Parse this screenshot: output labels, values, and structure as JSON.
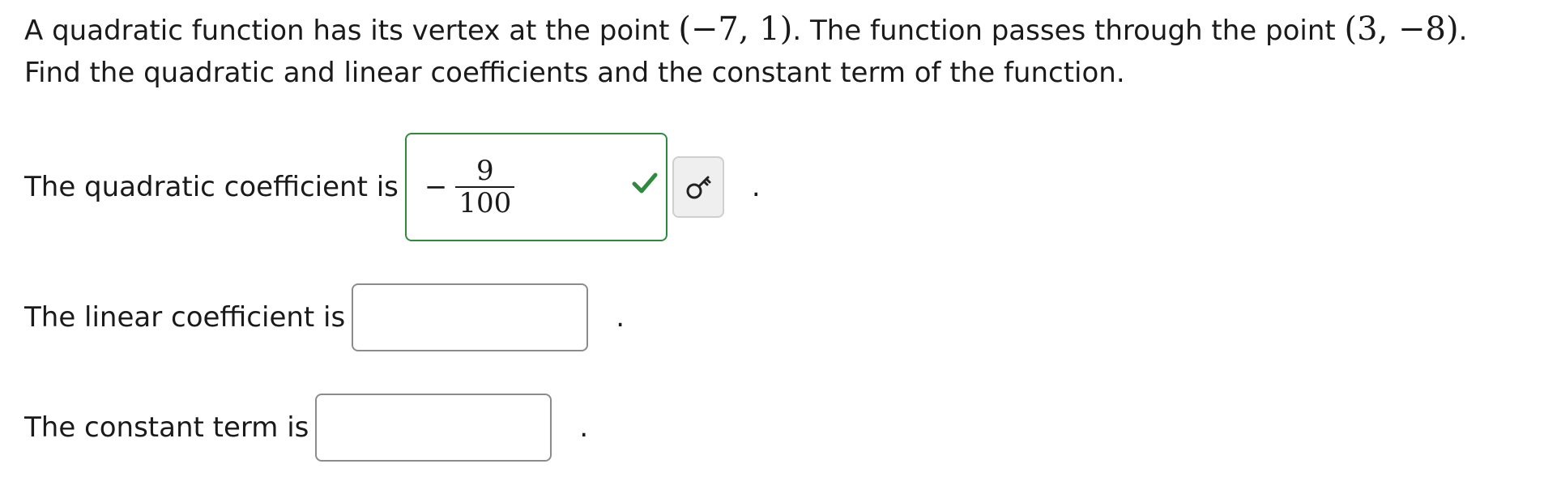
{
  "problem": {
    "line1_a": "A quadratic function has its vertex at the point ",
    "vertex": "(−7, 1)",
    "line1_b": ". The function passes through the point ",
    "point": "(3, −8)",
    "line1_c": ".",
    "line2": "Find the quadratic and linear coefficients and the constant term of the function."
  },
  "answers": {
    "quadratic": {
      "label": "The quadratic coefficient is",
      "sign": "−",
      "numerator": "9",
      "denominator": "100",
      "status": "correct",
      "trailing": "."
    },
    "linear": {
      "label": "The linear coefficient is",
      "value": "",
      "trailing": "."
    },
    "constant": {
      "label": "The constant term is",
      "value": "",
      "trailing": "."
    }
  },
  "colors": {
    "correct_border": "#2e8b3d",
    "check": "#2e8b3d",
    "box_border": "#8c8c8c"
  },
  "icons": {
    "status": "checkmark-icon",
    "key_button": "key-icon"
  }
}
